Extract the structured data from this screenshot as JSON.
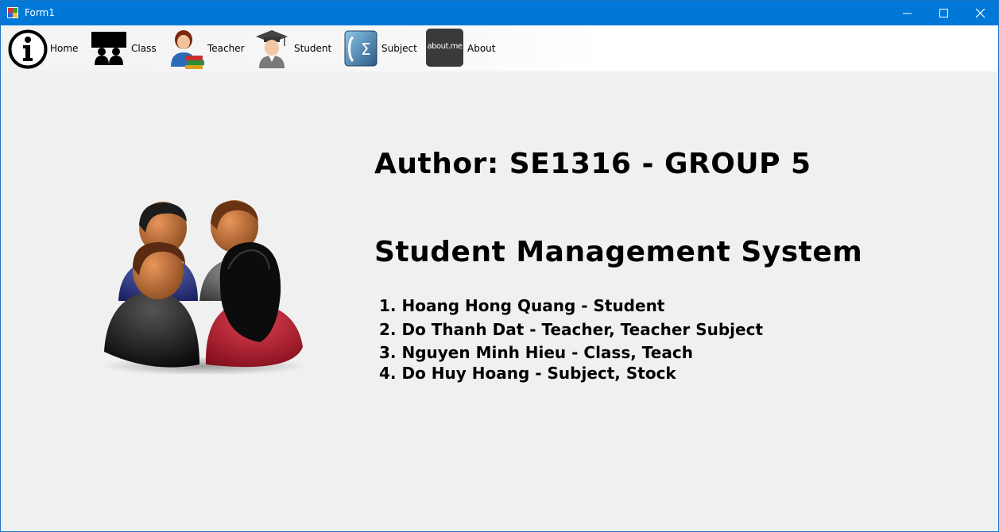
{
  "window": {
    "title": "Form1"
  },
  "menu": {
    "items": [
      {
        "label": "Home",
        "icon": "info-icon"
      },
      {
        "label": "Class",
        "icon": "class-icon"
      },
      {
        "label": "Teacher",
        "icon": "teacher-icon"
      },
      {
        "label": "Student",
        "icon": "student-icon"
      },
      {
        "label": "Subject",
        "icon": "subject-icon"
      },
      {
        "label": "About",
        "icon": "about-me-icon",
        "icon_text": "about.me"
      }
    ]
  },
  "content": {
    "author": "Author: SE1316 - GROUP 5",
    "system_title": "Student Management System",
    "members": [
      "1. Hoang Hong Quang - Student",
      "2. Do Thanh Dat - Teacher, Teacher Subject",
      "3. Nguyen Minh Hieu - Class, Teach",
      "4. Do Huy Hoang - Subject, Stock"
    ]
  },
  "colors": {
    "titlebar": "#0078d7",
    "background": "#f0f0f0"
  }
}
